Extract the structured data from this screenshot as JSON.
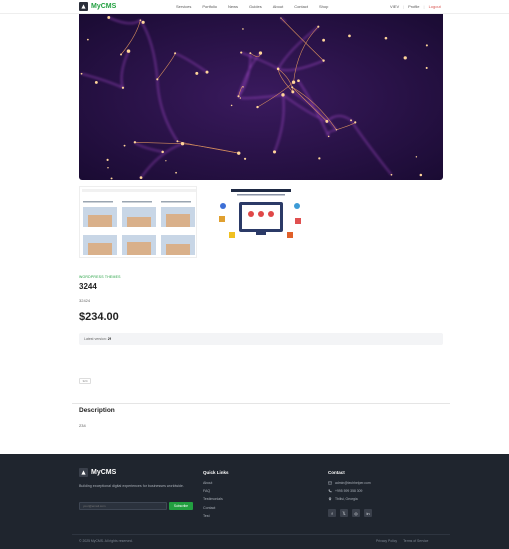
{
  "header": {
    "logo_text": "MyCMS",
    "nav": [
      "Services",
      "Portfolio",
      "News",
      "Guides",
      "About",
      "Contact",
      "Shop"
    ],
    "right": {
      "view": "VIEV",
      "profile": "Profile",
      "logout": "Logout"
    }
  },
  "product": {
    "category": "WORDPRESS THEMES",
    "title": "3244",
    "subtitle": "32424",
    "price": "$234.00",
    "version_label": "Latest version:",
    "version_value": "2f",
    "tag": "324"
  },
  "description": {
    "title": "Description",
    "text": "234"
  },
  "footer": {
    "logo_text": "MyCMS",
    "tagline": "Building exceptional digital experiences for businesses worldwide.",
    "email_placeholder": "your@email.com",
    "subscribe_label": "Subscribe",
    "quick_links_title": "Quick Links",
    "quick_links": [
      "About",
      "FAQ",
      "Testimonials",
      "Contact",
      "Test"
    ],
    "contact_title": "Contact",
    "contact": {
      "email": "admin@techhelper.com",
      "phone": "+995 599 358 309",
      "location": "Tbilisi, Georgia"
    },
    "socials": [
      "facebook-icon",
      "x-icon",
      "instagram-icon",
      "linkedin-icon"
    ],
    "copyright": "© 2025 MyCMS. All rights reserved.",
    "bottom_links": [
      "Privacy Policy",
      "Terms of Service"
    ]
  },
  "colors": {
    "accent": "#22a040",
    "footer_bg": "#1f252e",
    "logout": "#d9534f"
  }
}
